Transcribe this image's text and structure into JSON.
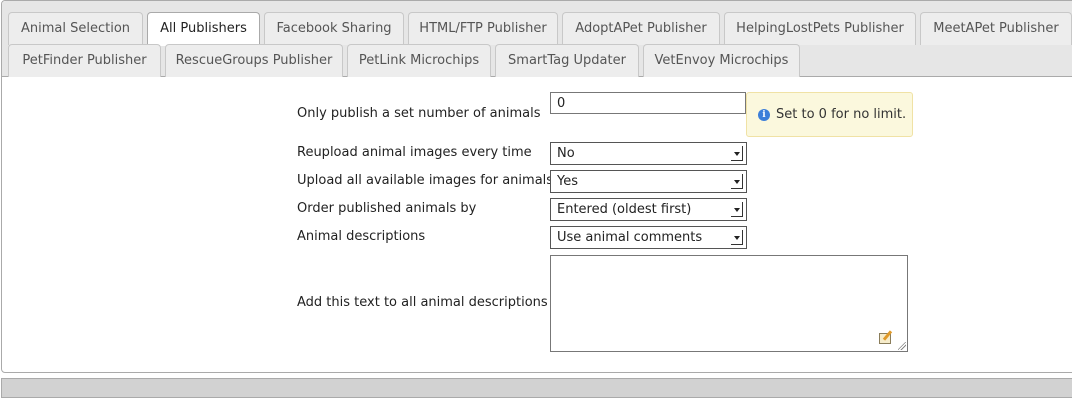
{
  "tabs": [
    {
      "label": "Animal Selection",
      "active": false
    },
    {
      "label": "All Publishers",
      "active": true
    },
    {
      "label": "Facebook Sharing",
      "active": false
    },
    {
      "label": "HTML/FTP Publisher",
      "active": false
    },
    {
      "label": "AdoptAPet Publisher",
      "active": false
    },
    {
      "label": "HelpingLostPets Publisher",
      "active": false
    },
    {
      "label": "MeetAPet Publisher",
      "active": false
    },
    {
      "label": "PetFinder Publisher",
      "active": false
    },
    {
      "label": "RescueGroups Publisher",
      "active": false
    },
    {
      "label": "PetLink Microchips",
      "active": false
    },
    {
      "label": "SmartTag Updater",
      "active": false
    },
    {
      "label": "VetEnvoy Microchips",
      "active": false
    }
  ],
  "form": {
    "limit": {
      "label": "Only publish a set number of animals",
      "value": "0",
      "hint": "Set to 0 for no limit.",
      "hint_icon": "info-icon"
    },
    "reupload": {
      "label": "Reupload animal images every time",
      "value": "No"
    },
    "upload_all": {
      "label": "Upload all available images for animals",
      "value": "Yes"
    },
    "order": {
      "label": "Order published animals by",
      "value": "Entered (oldest first)"
    },
    "descriptions": {
      "label": "Animal descriptions",
      "value": "Use animal comments"
    },
    "extra_text": {
      "label": "Add this text to all animal descriptions",
      "value": ""
    }
  },
  "colors": {
    "hint_background": "#fbf8dd",
    "hint_border": "#f0e2a5",
    "info_icon": "#3d7fd9",
    "tab_bar": "#e6e6e6"
  }
}
